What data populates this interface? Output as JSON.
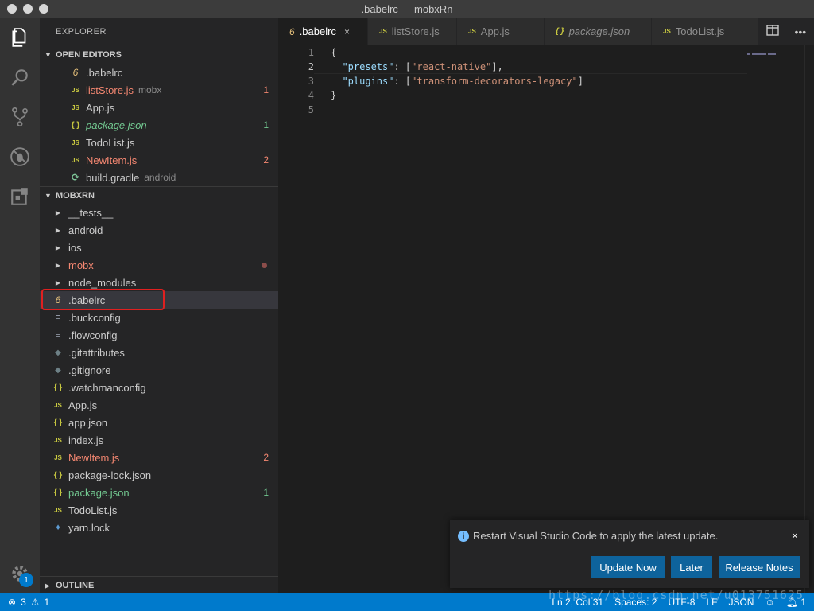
{
  "window": {
    "title": ".babelrc — mobxRn"
  },
  "activity_bar": {
    "items": [
      "files-icon",
      "search-icon",
      "source-control-icon",
      "debug-icon",
      "extensions-icon"
    ],
    "settings_badge": "1"
  },
  "sidebar": {
    "title": "EXPLORER",
    "open_editors": {
      "header": "OPEN EDITORS",
      "items": [
        {
          "icon": "6",
          "name": ".babelrc",
          "desc": "",
          "count": ""
        },
        {
          "icon": "JS",
          "name": "listStore.js",
          "desc": "mobx",
          "count": "1"
        },
        {
          "icon": "JS",
          "name": "App.js",
          "desc": "",
          "count": ""
        },
        {
          "icon": "{ }",
          "name": "package.json",
          "desc": "",
          "count": "1"
        },
        {
          "icon": "JS",
          "name": "TodoList.js",
          "desc": "",
          "count": ""
        },
        {
          "icon": "JS",
          "name": "NewItem.js",
          "desc": "",
          "count": "2"
        },
        {
          "icon": "gradle",
          "name": "build.gradle",
          "desc": "android",
          "count": ""
        }
      ]
    },
    "project": {
      "header": "MOBXRN",
      "folders": [
        "__tests__",
        "android",
        "ios",
        "mobx",
        "node_modules"
      ],
      "files": [
        {
          "icon": "6",
          "name": ".babelrc",
          "count": ""
        },
        {
          "icon": "≡",
          "name": ".buckconfig",
          "count": ""
        },
        {
          "icon": "≡",
          "name": ".flowconfig",
          "count": ""
        },
        {
          "icon": "◆",
          "name": ".gitattributes",
          "count": ""
        },
        {
          "icon": "◆",
          "name": ".gitignore",
          "count": ""
        },
        {
          "icon": "{ }",
          "name": ".watchmanconfig",
          "count": ""
        },
        {
          "icon": "JS",
          "name": "App.js",
          "count": ""
        },
        {
          "icon": "{ }",
          "name": "app.json",
          "count": ""
        },
        {
          "icon": "JS",
          "name": "index.js",
          "count": ""
        },
        {
          "icon": "JS",
          "name": "NewItem.js",
          "count": "2"
        },
        {
          "icon": "{ }",
          "name": "package-lock.json",
          "count": ""
        },
        {
          "icon": "{ }",
          "name": "package.json",
          "count": "1"
        },
        {
          "icon": "JS",
          "name": "TodoList.js",
          "count": ""
        },
        {
          "icon": "yarn",
          "name": "yarn.lock",
          "count": ""
        }
      ]
    },
    "outline_header": "OUTLINE"
  },
  "tabs": [
    {
      "icon": "6",
      "label": ".babelrc",
      "close": "×"
    },
    {
      "icon": "JS",
      "label": "listStore.js"
    },
    {
      "icon": "JS",
      "label": "App.js"
    },
    {
      "icon": "{ }",
      "label": "package.json"
    },
    {
      "icon": "JS",
      "label": "TodoList.js"
    }
  ],
  "editor": {
    "line_numbers": [
      "1",
      "2",
      "3",
      "4",
      "5"
    ],
    "lines": {
      "l1": "{",
      "l2_key": "\"presets\"",
      "l2_sep": ": [",
      "l2_val": "\"react-native\"",
      "l2_end": "],",
      "l3_key": "\"plugins\"",
      "l3_sep": ": [",
      "l3_val": "\"transform-decorators-legacy\"",
      "l3_end": "]",
      "l4": "}",
      "l5": ""
    }
  },
  "notification": {
    "message": "Restart Visual Studio Code to apply the latest update.",
    "buttons": [
      "Update Now",
      "Later",
      "Release Notes"
    ],
    "info": "i",
    "close": "×"
  },
  "status_bar": {
    "errors": "3",
    "warnings": "1",
    "position": "Ln 2, Col 31",
    "spaces": "Spaces: 2",
    "encoding": "UTF-8",
    "eol": "LF",
    "language": "JSON",
    "notifications": "1"
  },
  "watermark": "https://blog.csdn.net/u013751625",
  "colors": {
    "accent": "#007acc",
    "button": "#0e639c",
    "error_text": "#f48771",
    "modified_text": "#73c991"
  }
}
